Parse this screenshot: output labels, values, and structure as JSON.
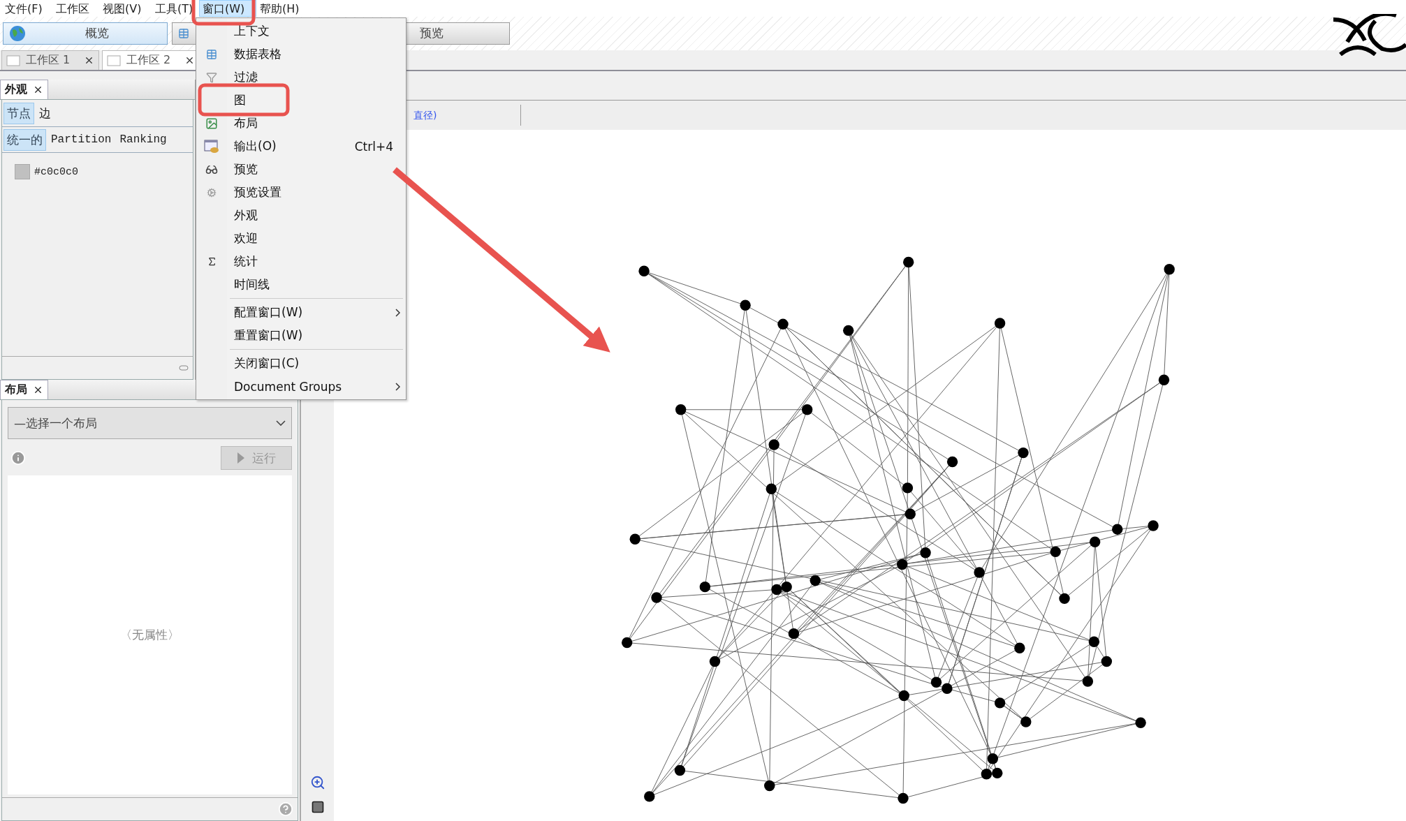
{
  "menu_bar": [
    {
      "label": "文件(F)",
      "selected": false
    },
    {
      "label": "工作区",
      "selected": false
    },
    {
      "label": "视图(V)",
      "selected": false
    },
    {
      "label": "工具(T)",
      "selected": false
    },
    {
      "label": "窗口(W)",
      "selected": true
    },
    {
      "label": "帮助(H)",
      "selected": false
    }
  ],
  "perspective_buttons": [
    {
      "label": "概览"
    },
    {
      "label": "预览"
    }
  ],
  "workspace_tabs": [
    {
      "label": "工作区 1",
      "selected": false
    },
    {
      "label": "工作区 2",
      "selected": true
    }
  ],
  "appearance_panel": {
    "title": "外观",
    "tabs": [
      {
        "label": "节点",
        "selected": true
      },
      {
        "label": "边",
        "selected": false
      }
    ],
    "modes": [
      {
        "label": "统一的",
        "selected": true
      },
      {
        "label": "Partition",
        "selected": false
      },
      {
        "label": "Ranking",
        "selected": false
      }
    ],
    "color_value": "#c0c0c0"
  },
  "graph_toolbar": {
    "link": "直径)"
  },
  "window_menu": [
    {
      "label": "上下文"
    },
    {
      "label": "数据表格"
    },
    {
      "label": "过滤"
    },
    {
      "label": "图"
    },
    {
      "label": "布局"
    },
    {
      "label": "输出(O)",
      "shortcut": "Ctrl+4"
    },
    {
      "label": "预览"
    },
    {
      "label": "预览设置"
    },
    {
      "label": "外观"
    },
    {
      "label": "欢迎"
    },
    {
      "label": "统计"
    },
    {
      "label": "时间线"
    },
    {
      "label": "配置窗口(W)",
      "submenu": true,
      "separator_before": true
    },
    {
      "label": "重置窗口(W)"
    },
    {
      "label": "关闭窗口(C)",
      "separator_before": true
    },
    {
      "label": "Document Groups",
      "submenu": true
    }
  ],
  "layout_panel": {
    "title": "布局",
    "select_value": "—选择一个布局",
    "run_button": {
      "label": "运行",
      "disabled": true
    },
    "empty_text": "〈无属性〉"
  }
}
